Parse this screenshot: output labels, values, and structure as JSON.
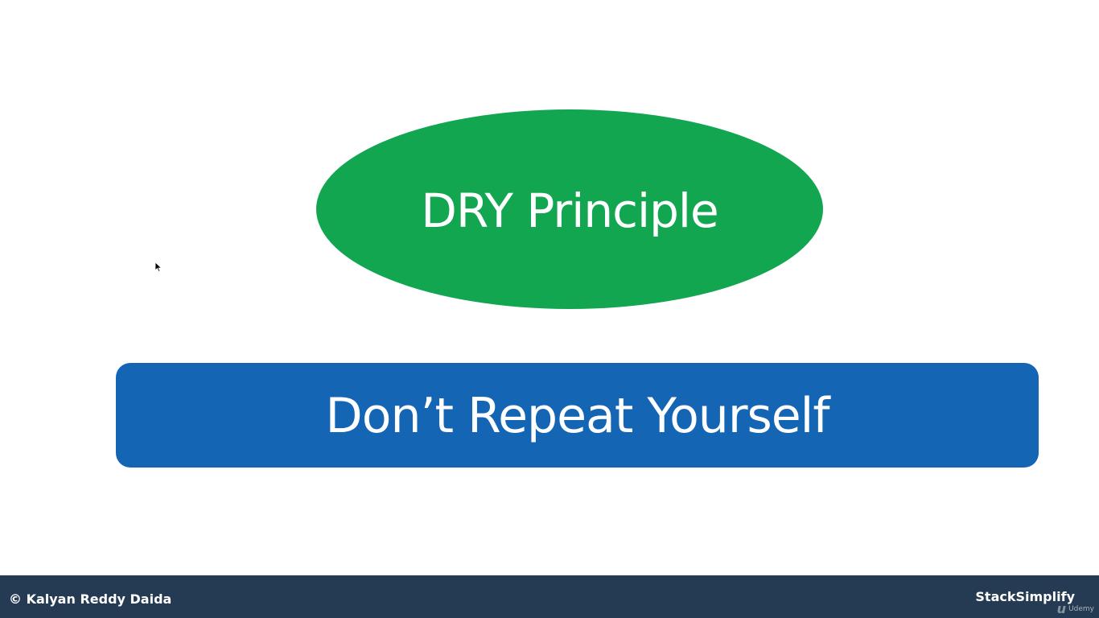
{
  "slide": {
    "title": "DRY Principle",
    "subtitle": "Don’t Repeat Yourself"
  },
  "footer": {
    "copyright": "© Kalyan Reddy Daida",
    "brand": "StackSimplify",
    "watermark_mark": "u",
    "watermark_text": "Udemy"
  },
  "colors": {
    "ellipse_fill": "#13a651",
    "banner_fill": "#1465b4",
    "footer_bg": "#243b53",
    "background": "#ffffff"
  },
  "icons": {
    "cursor": "mouse-pointer-icon"
  }
}
